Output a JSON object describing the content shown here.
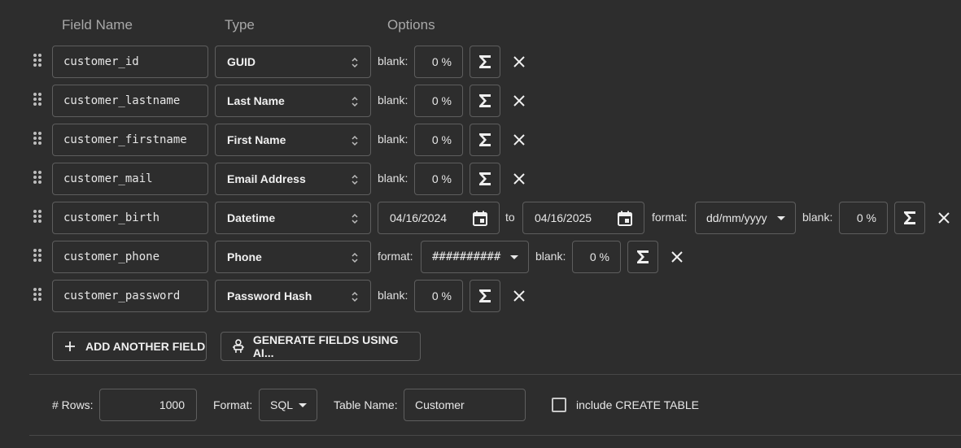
{
  "headers": {
    "field_name": "Field Name",
    "type": "Type",
    "options": "Options"
  },
  "fields": [
    {
      "name": "customer_id",
      "type": "GUID",
      "blank_label": "blank:",
      "blank": "0 %"
    },
    {
      "name": "customer_lastname",
      "type": "Last Name",
      "blank_label": "blank:",
      "blank": "0 %"
    },
    {
      "name": "customer_firstname",
      "type": "First Name",
      "blank_label": "blank:",
      "blank": "0 %"
    },
    {
      "name": "customer_mail",
      "type": "Email Address",
      "blank_label": "blank:",
      "blank": "0 %"
    },
    {
      "name": "customer_birth",
      "type": "Datetime",
      "from": "04/16/2024",
      "to_label": "to",
      "to": "04/16/2025",
      "format_label": "format:",
      "format": "dd/mm/yyyy",
      "blank_label": "blank:",
      "blank": "0 %"
    },
    {
      "name": "customer_phone",
      "type": "Phone",
      "format_label": "format:",
      "format": "##########",
      "blank_label": "blank:",
      "blank": "0 %"
    },
    {
      "name": "customer_password",
      "type": "Password Hash",
      "blank_label": "blank:",
      "blank": "0 %"
    }
  ],
  "actions": {
    "add_field": "ADD ANOTHER FIELD",
    "generate_ai": "GENERATE FIELDS USING AI..."
  },
  "settings": {
    "rows_label": "# Rows:",
    "rows": "1000",
    "format_label": "Format:",
    "format": "SQL",
    "table_label": "Table Name:",
    "table": "Customer",
    "create_table_label": "include CREATE TABLE",
    "create_table_checked": false
  },
  "icons": {
    "drag": "drag-handle-icon",
    "sort": "unfold-icon",
    "sigma": "sigma-icon",
    "close": "close-icon",
    "calendar": "calendar-icon",
    "plus": "plus-icon",
    "ai": "robot-icon",
    "caret": "caret-down-icon"
  },
  "colors": {
    "background": "#2d2d2d",
    "border": "#5e5e5e",
    "text": "#e8e8e8",
    "muted": "#a8a8a8"
  }
}
